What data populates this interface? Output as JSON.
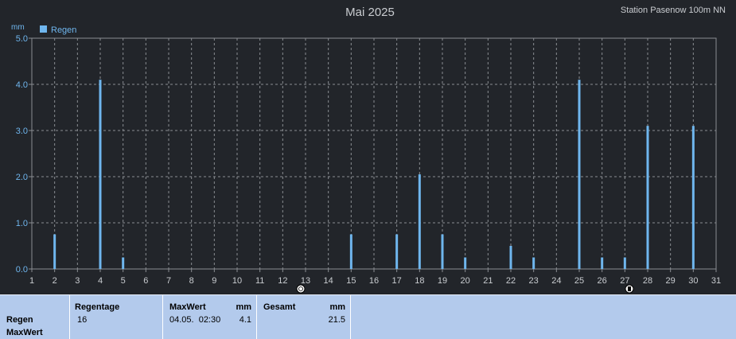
{
  "chart_data": {
    "type": "bar",
    "title": "Mai 2025",
    "station": "Station Pasenow 100m NN",
    "ylabel": "mm",
    "ylim": [
      0,
      5
    ],
    "yticks": [
      "0.0",
      "1.0",
      "2.0",
      "3.0",
      "4.0",
      "5.0"
    ],
    "x": [
      1,
      2,
      3,
      4,
      5,
      6,
      7,
      8,
      9,
      10,
      11,
      12,
      13,
      14,
      15,
      16,
      17,
      18,
      19,
      20,
      21,
      22,
      23,
      24,
      25,
      26,
      27,
      28,
      29,
      30,
      31
    ],
    "series": [
      {
        "name": "Regen",
        "color": "#6fb6ee",
        "values": [
          0,
          0.75,
          0,
          4.1,
          0.25,
          0,
          0,
          0,
          0,
          0,
          0,
          0,
          0,
          0,
          0.75,
          0,
          0.75,
          2.05,
          0.75,
          0.25,
          0,
          0.5,
          0.25,
          0,
          4.1,
          0.25,
          0.25,
          3.1,
          0,
          3.1,
          0
        ]
      }
    ],
    "grid": true,
    "legend": "top-left"
  },
  "footer": {
    "row_label": "Regen",
    "max_label": "MaxWert",
    "regentage_header": "Regentage",
    "regentage_value": "16",
    "maxwert_header": "MaxWert",
    "maxwert_unit": "mm",
    "maxwert_date": "04.05.  02:30",
    "maxwert_value": "4.1",
    "gesamt_header": "Gesamt",
    "gesamt_unit": "mm",
    "gesamt_value": "21.5"
  }
}
